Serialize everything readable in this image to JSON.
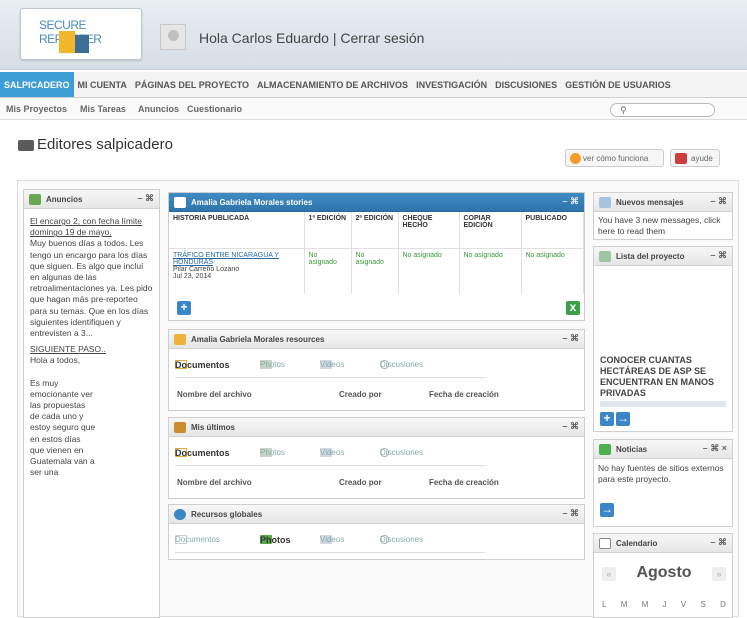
{
  "header": {
    "logo_text": "SECURE REPORTER",
    "greeting": "Hola Carlos Eduardo",
    "separator": "|",
    "logout": "Cerrar sesión"
  },
  "nav": {
    "items": [
      {
        "label": "SALPICADERO"
      },
      {
        "label": "MI CUENTA"
      },
      {
        "label": "PÁGINAS DEL PROYECTO"
      },
      {
        "label": "ALMACENAMIENTO DE ARCHIVOS"
      },
      {
        "label": "INVESTIGACIÓN"
      },
      {
        "label": "DISCUSIONES"
      },
      {
        "label": "GESTIÓN DE USUARIOS"
      }
    ]
  },
  "subnav": {
    "items": [
      {
        "label": "Mis Proyectos"
      },
      {
        "label": "Mis Tareas"
      },
      {
        "label": "Anuncios"
      },
      {
        "label": "Cuestionario"
      }
    ],
    "search_placeholder": ""
  },
  "page": {
    "title": "Editores salpicadero",
    "how_label": "ver cómo funciona",
    "help_label": "ayude"
  },
  "panels": {
    "ctrl": "– ⌘",
    "ctrl_close": "– ⌘ ×",
    "anuncios": {
      "title": "Anuncios",
      "link1": "El encargo 2, con fecha límite domingo 19 de mayo,",
      "text1": "Muy buenos días a todos. Les tengo un encargo para los días que siguen. Es algo que incluí en algunas de las retroalimentaciones ya. Les pido que hagan más pre-reporteo para su temas. Que en los días siguientes identifiquen y entrevisten a 3...",
      "link2": "SIGUIENTE PASO..",
      "text2": "Hola a todos,",
      "text3": "Es muy emocionante ver las propuestas de cada uno y estoy seguro que en estos días que vienen en Guatemala van a ser una"
    },
    "stories": {
      "title": "Amalia Gabriela Morales stories",
      "headers": [
        "HISTORIA PUBLICADA",
        "1ª EDICIÓN",
        "2ª EDICIÓN",
        "CHEQUE HECHO",
        "COPIAR EDICIÓN",
        "PUBLICADO"
      ],
      "row": {
        "title": "TRÁFICO ENTRE NICARAGUA Y HONDURAS",
        "author": "Pilar Carreño Lozano",
        "date": "Jul 23, 2014",
        "c1": "No asignado",
        "c2": "No asignado",
        "c3": "No asignado",
        "c4": "No asignado",
        "c5": "No asignado"
      }
    },
    "resources": {
      "title": "Amalia Gabriela Morales resources",
      "tabs": [
        "Documentos",
        "Photos",
        "Videos",
        "Discusiones"
      ],
      "cols": [
        "Nombre del archivo",
        "Creado por",
        "Fecha de creación"
      ]
    },
    "latest": {
      "title": "Mis últimos",
      "tabs": [
        "Documentos",
        "Photos",
        "Videos",
        "Discusiones"
      ],
      "cols": [
        "Nombre del archivo",
        "Creado por",
        "Fecha de creación"
      ]
    },
    "global": {
      "title": "Recursos globales",
      "tabs": [
        "Documentos",
        "Photos",
        "Videos",
        "Discusiones"
      ]
    },
    "messages": {
      "title": "Nuevos mensajes",
      "text": "You have 3 new messages, click here to read them"
    },
    "project_list": {
      "title": "Lista del proyecto",
      "item": "CONOCER CUANTAS HECTÁREAS DE ASP SE ENCUENTRAN EN MANOS PRIVADAS"
    },
    "news": {
      "title": "Noticias",
      "text": "No hay fuentes de sitios externos para este proyecto."
    },
    "calendar": {
      "title": "Calendario",
      "month": "Agosto",
      "prev": "«",
      "next": "»",
      "days": [
        "L",
        "M",
        "M",
        "J",
        "V",
        "S",
        "D"
      ]
    }
  },
  "colors": {
    "accent": "#3e9ed6",
    "panel_header_blue": "#2e74ab",
    "status_green": "#3a9a3a",
    "link": "#2a6aa8"
  }
}
